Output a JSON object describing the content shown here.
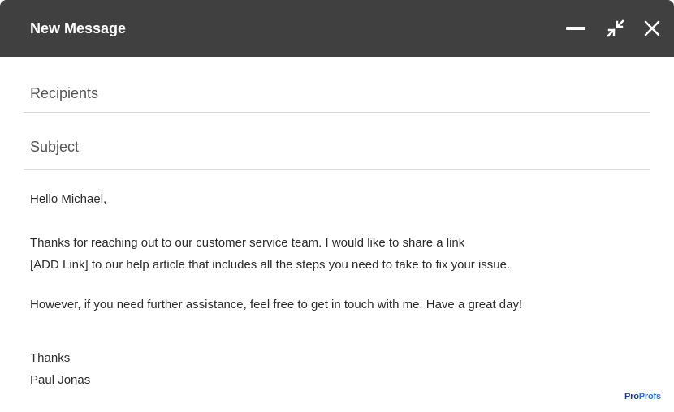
{
  "window": {
    "title": "New Message",
    "controls": {
      "minimize_icon": "minimize-icon",
      "shrink_icon": "exit-fullscreen-icon",
      "close_icon": "close-icon"
    },
    "colors": {
      "titlebar": "#404040",
      "title_text": "#ffffff"
    }
  },
  "fields": {
    "recipients_label": "Recipients",
    "subject_label": "Subject"
  },
  "message": {
    "greeting": "Hello Michael,",
    "line1": "Thanks for reaching out to our customer service team. I would like to share a link",
    "line2": "[ADD Link] to our help article that includes all the steps you need to take to fix your issue.",
    "line3": "However, if you need further assistance, feel free to get in touch with me. Have a great day!",
    "signoff": "Thanks",
    "signature": "Paul Jonas"
  },
  "branding": {
    "logo_part1": "Pro",
    "logo_part2": "Profs"
  }
}
